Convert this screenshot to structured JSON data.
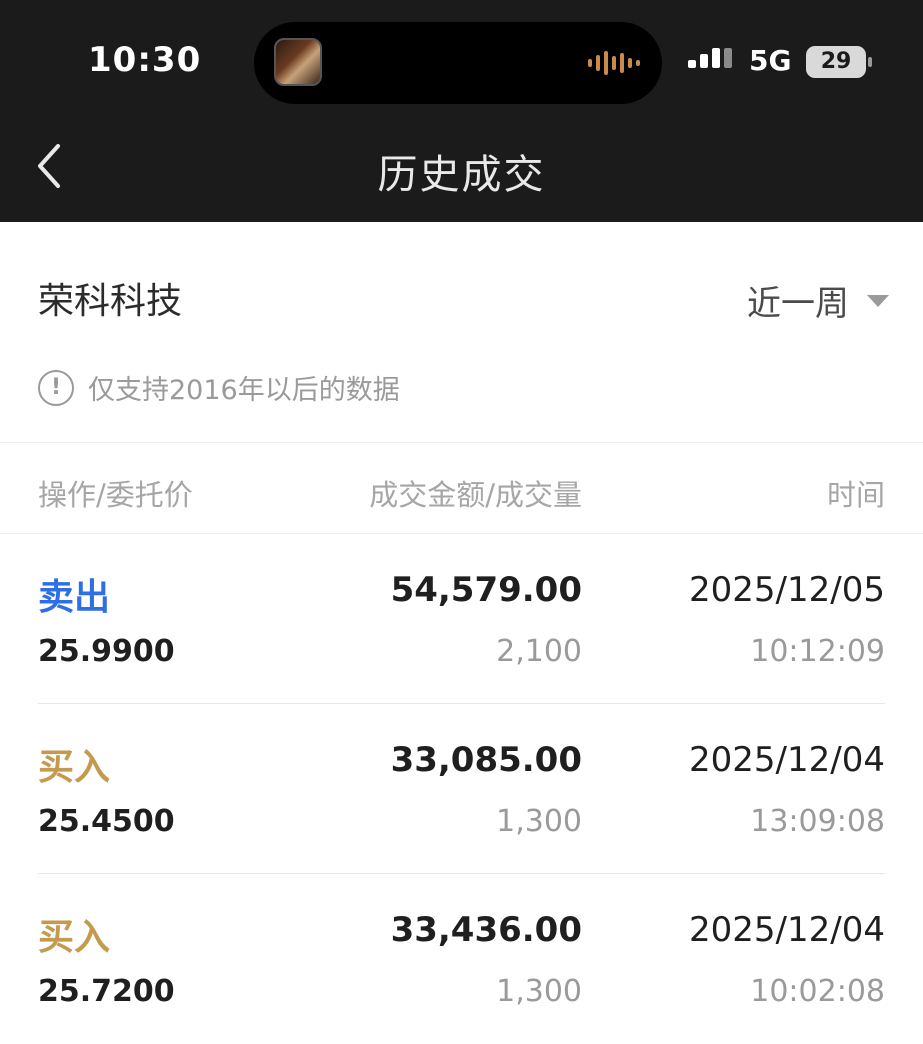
{
  "status_bar": {
    "time": "10:30",
    "network": "5G",
    "battery": "29"
  },
  "nav": {
    "title": "历史成交",
    "back_icon": "chevron-left-icon"
  },
  "filter": {
    "stock_name": "荣科科技",
    "range_label": "近一周"
  },
  "notice": {
    "icon": "info-icon",
    "text": "仅支持2016年以后的数据"
  },
  "columns": {
    "col1": "操作/委托价",
    "col2": "成交金额/成交量",
    "col3": "时间"
  },
  "colors": {
    "sell": "#2f6fe6",
    "buy": "#c49a4e"
  },
  "trades": [
    {
      "op": "卖出",
      "side": "sell",
      "price": "25.9900",
      "amount": "54,579.00",
      "volume": "2,100",
      "date": "2025/12/05",
      "time": "10:12:09"
    },
    {
      "op": "买入",
      "side": "buy",
      "price": "25.4500",
      "amount": "33,085.00",
      "volume": "1,300",
      "date": "2025/12/04",
      "time": "13:09:08"
    },
    {
      "op": "买入",
      "side": "buy",
      "price": "25.7200",
      "amount": "33,436.00",
      "volume": "1,300",
      "date": "2025/12/04",
      "time": "10:02:08"
    }
  ]
}
